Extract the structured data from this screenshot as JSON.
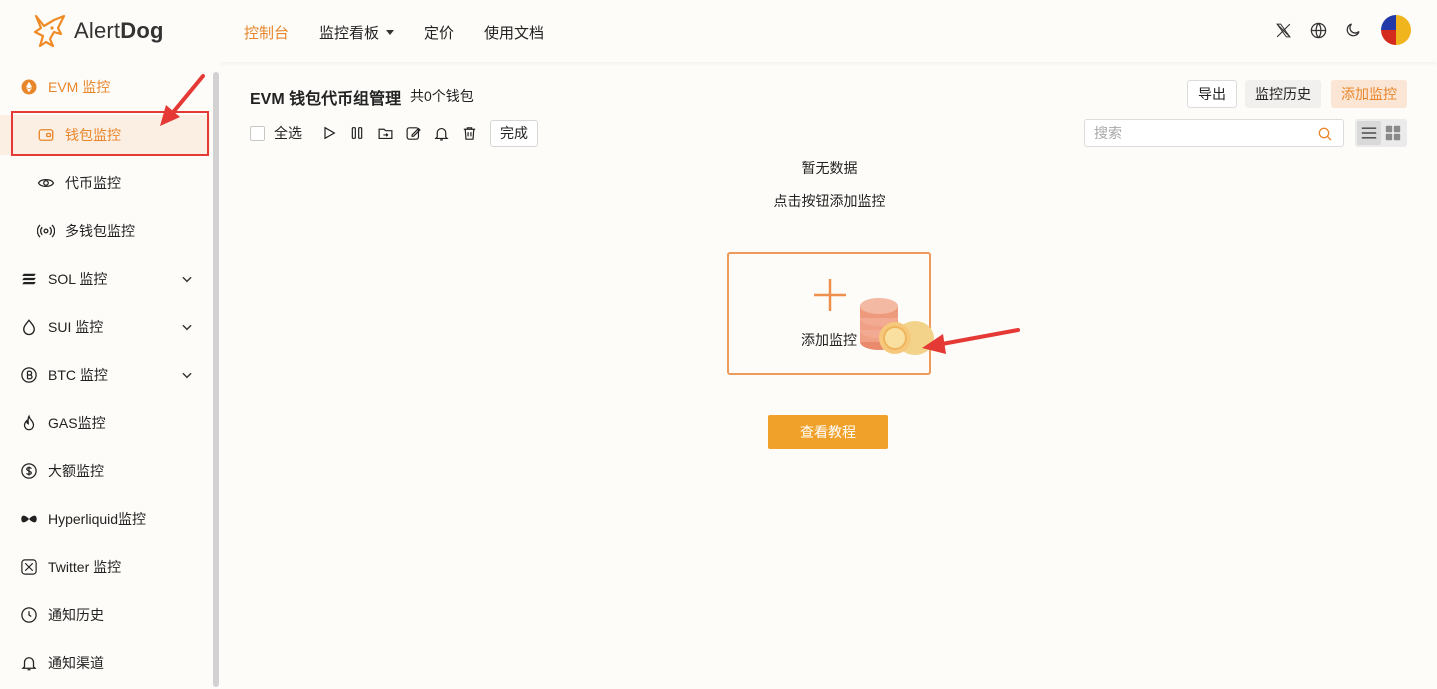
{
  "brand": {
    "name_light": "Alert",
    "name_bold": "Dog"
  },
  "nav": [
    {
      "label": "控制台",
      "active": true,
      "has_caret": false
    },
    {
      "label": "监控看板",
      "active": false,
      "has_caret": true
    },
    {
      "label": "定价",
      "active": false,
      "has_caret": false
    },
    {
      "label": "使用文档",
      "active": false,
      "has_caret": false
    }
  ],
  "top_icons": [
    "x-icon",
    "globe-icon",
    "moon-icon"
  ],
  "sidebar": {
    "items": [
      {
        "label": "EVM 监控",
        "icon": "ethereum-icon",
        "state": "group-active"
      },
      {
        "label": "钱包监控",
        "icon": "wallet-icon",
        "state": "selected",
        "sub": true
      },
      {
        "label": "代币监控",
        "icon": "eye-icon",
        "sub": true
      },
      {
        "label": "多钱包监控",
        "icon": "broadcast-icon",
        "sub": true
      },
      {
        "label": "SOL 监控",
        "icon": "solana-icon",
        "expandable": true
      },
      {
        "label": "SUI 监控",
        "icon": "droplet-icon",
        "expandable": true
      },
      {
        "label": "BTC 监控",
        "icon": "bitcoin-icon",
        "expandable": true
      },
      {
        "label": "GAS监控",
        "icon": "flame-icon"
      },
      {
        "label": "大额监控",
        "icon": "dollar-icon"
      },
      {
        "label": "Hyperliquid监控",
        "icon": "hyperliquid-icon"
      },
      {
        "label": "Twitter 监控",
        "icon": "x-icon"
      },
      {
        "label": "通知历史",
        "icon": "history-icon"
      },
      {
        "label": "通知渠道",
        "icon": "bell-icon"
      }
    ]
  },
  "main": {
    "title": "EVM 钱包代币组管理",
    "count": "共0个钱包",
    "buttons": {
      "export": "导出",
      "history": "监控历史",
      "add": "添加监控"
    },
    "toolbar": {
      "select_all": "全选",
      "done": "完成"
    },
    "search": {
      "placeholder": "搜索",
      "value": ""
    },
    "empty": {
      "line1": "暂无数据",
      "line2": "点击按钮添加监控"
    },
    "add_card_label": "添加监控",
    "tutorial_button": "查看教程"
  },
  "colors": {
    "accent": "#e8862b",
    "button_orange": "#f0a12a",
    "annotation_red": "#e53935"
  }
}
